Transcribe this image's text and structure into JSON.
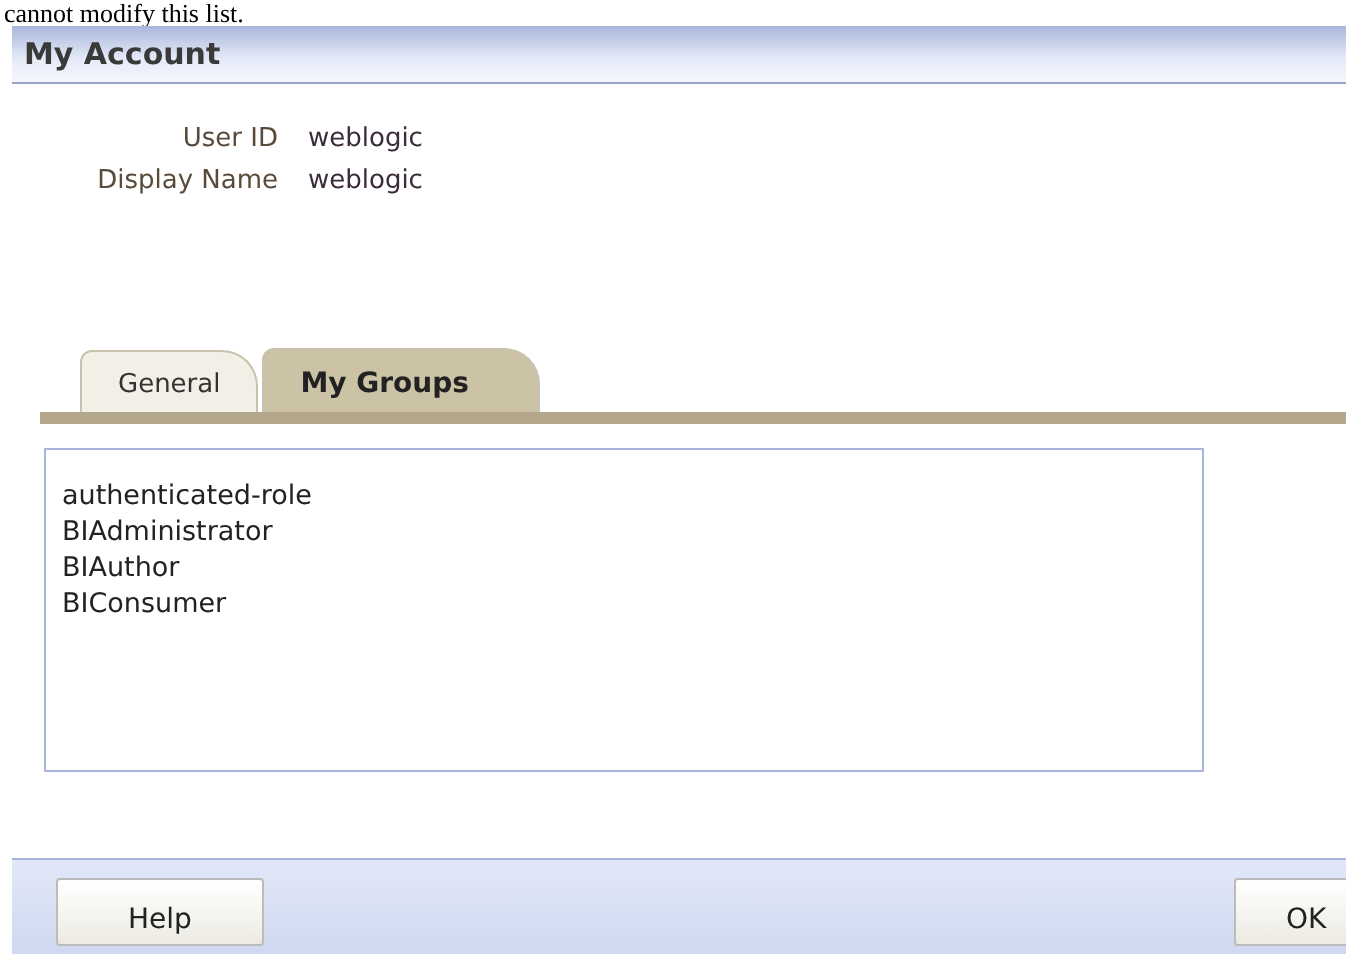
{
  "top_text": "cannot modify this list.",
  "window": {
    "title": "My Account"
  },
  "fields": [
    {
      "label": "User ID",
      "value": "weblogic"
    },
    {
      "label": "Display Name",
      "value": "weblogic"
    }
  ],
  "tabs": [
    {
      "label": "General",
      "selected": false
    },
    {
      "label": "My Groups",
      "selected": true
    }
  ],
  "groups": [
    "authenticated-role",
    "BIAdministrator",
    "BIAuthor",
    "BIConsumer"
  ],
  "buttons": [
    {
      "label": "Help",
      "kind": "left"
    },
    {
      "label": "OK",
      "kind": "right"
    }
  ]
}
